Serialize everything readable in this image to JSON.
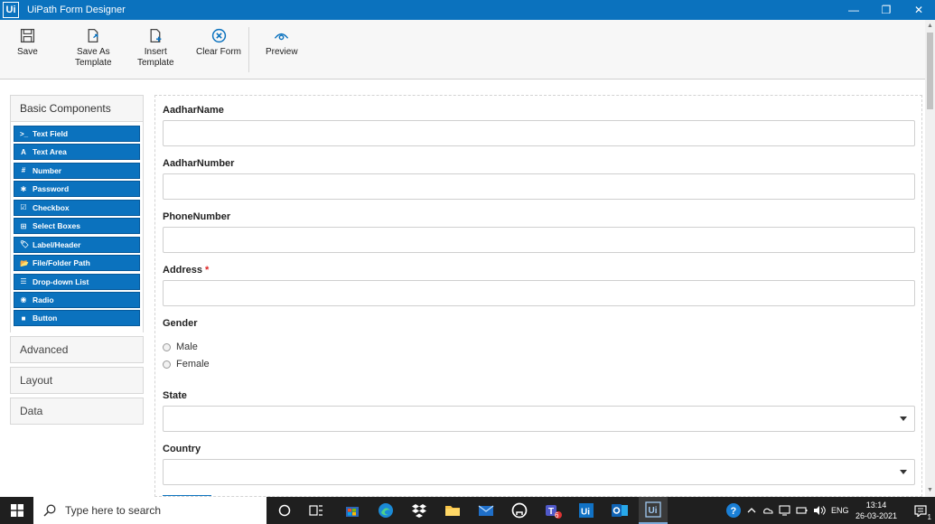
{
  "window": {
    "logo": "Ui",
    "title": "UiPath Form Designer",
    "controls": {
      "minimize": "—",
      "restore": "❐",
      "close": "✕"
    }
  },
  "toolbar": {
    "save": "Save",
    "save_as_template": [
      "Save As",
      "Template"
    ],
    "insert_template": [
      "Insert",
      "Template"
    ],
    "clear_form": "Clear Form",
    "preview": "Preview"
  },
  "sidebar": {
    "basic_components": "Basic Components",
    "components": [
      {
        "icon": ">_",
        "label": "Text Field"
      },
      {
        "icon": "A",
        "label": "Text Area"
      },
      {
        "icon": "#",
        "label": "Number"
      },
      {
        "icon": "✱",
        "label": "Password"
      },
      {
        "icon": "☑",
        "label": "Checkbox"
      },
      {
        "icon": "⊞",
        "label": "Select Boxes"
      },
      {
        "icon": "🏷",
        "label": "Label/Header"
      },
      {
        "icon": "📂",
        "label": "File/Folder Path"
      },
      {
        "icon": "☰",
        "label": "Drop-down List"
      },
      {
        "icon": "◉",
        "label": "Radio"
      },
      {
        "icon": "■",
        "label": "Button"
      }
    ],
    "advanced": "Advanced",
    "layout": "Layout",
    "data": "Data"
  },
  "form": {
    "fields": [
      {
        "label": "AadharName",
        "value": ""
      },
      {
        "label": "AadharNumber",
        "value": ""
      },
      {
        "label": "PhoneNumber",
        "value": ""
      },
      {
        "label": "Address",
        "required_mark": "*",
        "value": ""
      }
    ],
    "gender": {
      "label": "Gender",
      "options": [
        "Male",
        "Female"
      ]
    },
    "state": {
      "label": "State",
      "value": ""
    },
    "country": {
      "label": "Country",
      "value": ""
    }
  },
  "taskbar": {
    "search_placeholder": "Type here to search",
    "teams_badge": "6",
    "language": "ENG",
    "time": "13:14",
    "date": "26-03-2021",
    "notification_count": "1"
  },
  "colors": {
    "accent": "#0b72be",
    "required": "#d22222",
    "taskbar": "#1f1f1f"
  }
}
